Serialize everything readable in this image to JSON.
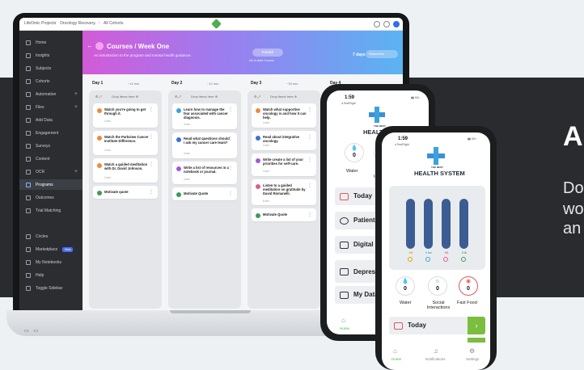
{
  "hero": {
    "title": "A",
    "lines": [
      "Do",
      "wo",
      "an"
    ]
  },
  "app": {
    "breadcrumb": [
      "LifeOmic Projects",
      "Oncology Recovery",
      "All Cohorts"
    ],
    "sidebar": {
      "items": [
        {
          "label": "Home"
        },
        {
          "label": "Insights"
        },
        {
          "label": "Subjects"
        },
        {
          "label": "Cohorts"
        },
        {
          "label": "Automation"
        },
        {
          "label": "Files"
        },
        {
          "label": "Add Data"
        },
        {
          "label": "Engagement"
        },
        {
          "label": "Surveys"
        },
        {
          "label": "Content"
        },
        {
          "label": "OCR"
        },
        {
          "label": "Programs"
        },
        {
          "label": "Outcomes"
        },
        {
          "label": "Trial Matching"
        },
        {
          "label": "Circles"
        },
        {
          "label": "Marketplace",
          "badge": "Beta"
        },
        {
          "label": "My Notebooks"
        },
        {
          "label": "Help"
        },
        {
          "label": "Toggle Sidebar"
        }
      ],
      "active": "Programs"
    },
    "banner": {
      "title": "Courses / Week One",
      "subtitle": "An introduction to the program and mental health guidance.",
      "publish_label": "Publish",
      "publish_note": "No in-date Course",
      "days_label": "7 days",
      "search_placeholder": "Select this",
      "colors": {
        "start": "#d35ad8",
        "end": "#5ab4f2"
      }
    },
    "columns": [
      {
        "title": "Day 1",
        "time": "~14 min",
        "tools": "Drop items here",
        "cards": [
          {
            "text": "Watch you're going to get through it.",
            "meta": "4 min",
            "color": "#f08a3c"
          },
          {
            "text": "Watch the Parkview Cancer Institute Difference.",
            "meta": "4 min",
            "color": "#f08a3c"
          },
          {
            "text": "Watch a guided meditation with Dr. David Johnson.",
            "meta": "4 min",
            "color": "#f08a3c"
          },
          {
            "text": "Motivate quote",
            "meta": "",
            "color": "#3f9a5c"
          }
        ]
      },
      {
        "title": "Day 2",
        "time": "~12 min",
        "tools": "Drop items here",
        "cards": [
          {
            "text": "Learn how to manage the fear associated with cancer diagnosis.",
            "meta": "4 min",
            "color": "#3aa3d9"
          },
          {
            "text": "Read what questions should I ask my cancer care team?",
            "meta": "4 min",
            "color": "#3c6fd9"
          },
          {
            "text": "Write a list of resources in a notebook or journal.",
            "meta": "4 min",
            "color": "#a25ad8"
          },
          {
            "text": "Motivate Quote",
            "meta": "",
            "color": "#3f9a5c"
          }
        ]
      },
      {
        "title": "Day 3",
        "time": "~33 min",
        "tools": "Drop items here",
        "cards": [
          {
            "text": "Watch what supportive oncology is and how it can help.",
            "meta": "4 min",
            "color": "#f08a3c"
          },
          {
            "text": "Read about integrative oncology.",
            "meta": "4 min",
            "color": "#3c6fd9"
          },
          {
            "text": "Write create a list of your priorities for self-care.",
            "meta": "4 min",
            "color": "#a25ad8"
          },
          {
            "text": "Listen to a guided meditation on gratitude by David Romanelli.",
            "meta": "8 min",
            "color": "#e05a8a"
          },
          {
            "text": "Motivate Quote",
            "meta": "",
            "color": "#3f9a5c"
          }
        ]
      },
      {
        "title": "Day 4",
        "time": "",
        "tools": "",
        "cards": []
      }
    ],
    "ports": "▭ ▭"
  },
  "phone1": {
    "time": "1:59",
    "carrier": "◂ TestFlight",
    "signal": "▮▮ 5G▪",
    "brand_small": "THE BEST",
    "brand": "HEALTH S",
    "metrics": [
      {
        "label": "Water",
        "value": "0",
        "icon": "droplet-icon"
      },
      {
        "label": "In",
        "value": "",
        "icon": "person-icon"
      }
    ],
    "menu": [
      "Today",
      "Patient",
      "Digital E",
      "Depress Assessm",
      "My Data"
    ],
    "nav": [
      "Home",
      "N"
    ]
  },
  "phone2": {
    "time": "1:59",
    "carrier": "◂ TestFlight",
    "signal": "▮▮ 5G▪",
    "brand_small": "THE BEST",
    "brand": "HEALTH SYSTEM",
    "bars": [
      {
        "label": "0/8",
        "fill": 1.0,
        "color": "#d9a800"
      },
      {
        "label": "0 hrs",
        "fill": 1.0,
        "color": "#3aa3d9"
      },
      {
        "label": "0/4",
        "fill": 1.0,
        "color": "#e05a8a"
      },
      {
        "label": "0 lb",
        "fill": 1.0,
        "color": "#3f9a5c"
      }
    ],
    "metrics": [
      {
        "label": "Water",
        "value": "0",
        "icon": "droplet-icon"
      },
      {
        "label": "Social Interactions",
        "value": "0",
        "icon": "smile-icon"
      },
      {
        "label": "Fast Food",
        "value": "0",
        "icon": "food-icon"
      }
    ],
    "today_label": "Today",
    "nav": [
      "Home",
      "Notifications",
      "Settings"
    ]
  }
}
